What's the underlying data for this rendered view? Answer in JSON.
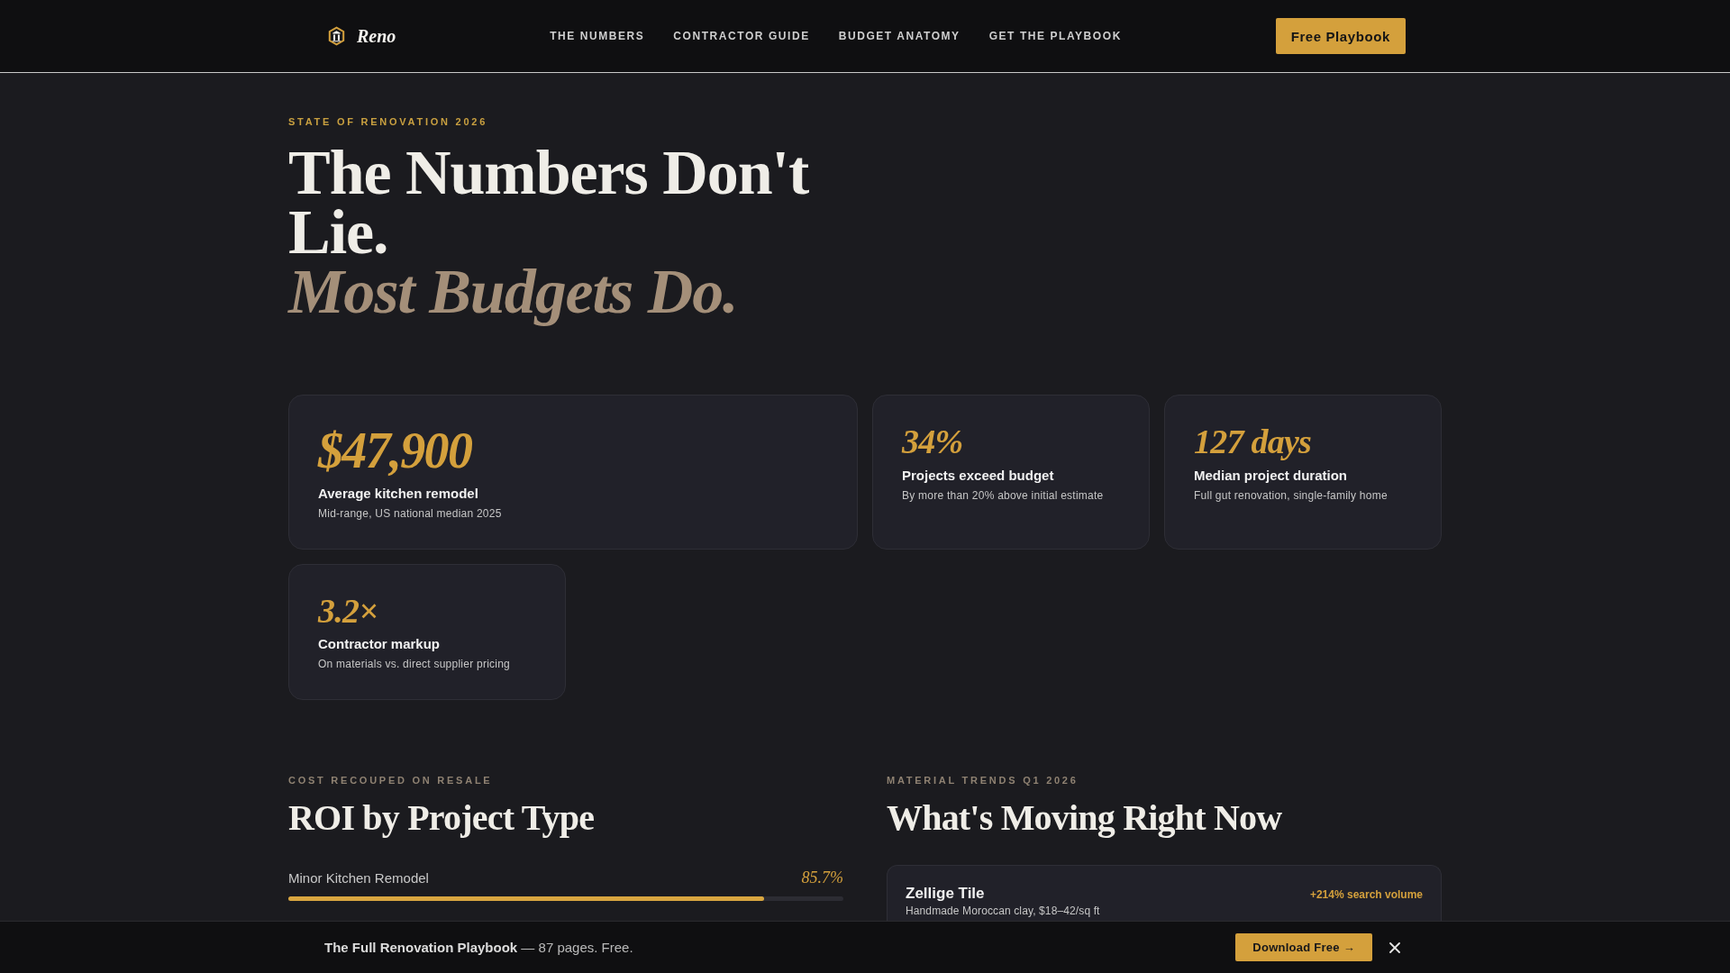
{
  "nav": {
    "brand": "Reno",
    "links": [
      "THE NUMBERS",
      "CONTRACTOR GUIDE",
      "BUDGET ANATOMY",
      "GET THE PLAYBOOK"
    ],
    "cta": "Free Playbook"
  },
  "hero": {
    "eyebrow": "STATE OF RENOVATION 2026",
    "heading": "The Numbers Don't Lie.",
    "tagline": "Most Budgets Do."
  },
  "stats": [
    {
      "kind": "featured",
      "value": "$47,900",
      "label": "Average kitchen remodel",
      "note": "Mid-range, US national median 2025"
    },
    {
      "kind": "standard",
      "value": "34%",
      "label": "Projects exceed budget",
      "note": "By more than 20% above initial estimate"
    },
    {
      "kind": "standard",
      "value": "127 days",
      "label": "Median project duration",
      "note": "Full gut renovation, single-family home"
    },
    {
      "kind": "standard",
      "value": "3.2×",
      "label": "Contractor markup",
      "note": "On materials vs. direct supplier pricing"
    }
  ],
  "roi": {
    "eyebrow": "COST RECOUPED ON RESALE",
    "title": "ROI by Project Type",
    "rows": [
      {
        "name": "Minor Kitchen Remodel",
        "value": "85.7%",
        "level": 0.857
      }
    ]
  },
  "trends": {
    "eyebrow": "MATERIAL TRENDS Q1 2026",
    "title": "What's Moving Right Now",
    "items": [
      {
        "name": "Zellige Tile",
        "badge": "+214% search volume",
        "description": "Handmade Moroccan clay, $18–42/sq ft"
      }
    ]
  },
  "banner": {
    "text": "**The Full Renovation Playbook** — 87 pages. Free.",
    "button": "Download Free →"
  }
}
